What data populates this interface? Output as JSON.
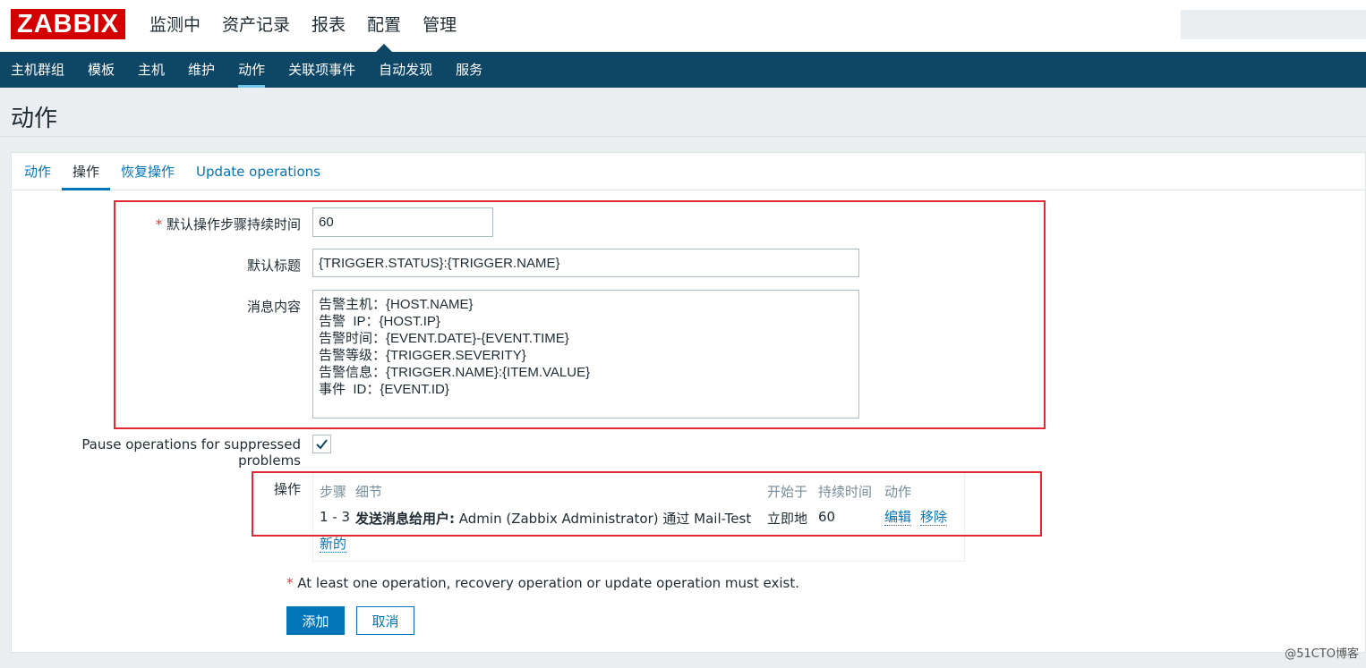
{
  "logo": "ZABBIX",
  "main_menu": [
    "监测中",
    "资产记录",
    "报表",
    "配置",
    "管理"
  ],
  "sub_menu": [
    "主机群组",
    "模板",
    "主机",
    "维护",
    "动作",
    "关联项事件",
    "自动发现",
    "服务"
  ],
  "page_title": "动作",
  "tabs": [
    "动作",
    "操作",
    "恢复操作",
    "Update operations"
  ],
  "form": {
    "step_duration_label": "默认操作步骤持续时间",
    "step_duration_value": "60",
    "subject_label": "默认标题",
    "subject_value": "{TRIGGER.STATUS}:{TRIGGER.NAME}",
    "message_label": "消息内容",
    "message_value": "告警主机：{HOST.NAME}\n告警  IP：{HOST.IP}\n告警时间：{EVENT.DATE}-{EVENT.TIME}\n告警等级：{TRIGGER.SEVERITY}\n告警信息：{TRIGGER.NAME}:{ITEM.VALUE}\n事件  ID：{EVENT.ID}",
    "pause_label": "Pause operations for suppressed problems",
    "pause_checked": true
  },
  "operations": {
    "label": "操作",
    "headers": {
      "steps": "步骤",
      "details": "细节",
      "start_in": "开始于",
      "duration": "持续时间",
      "action": "动作"
    },
    "rows": [
      {
        "steps": "1 - 3",
        "detail_bold": "发送消息给用户:",
        "detail_rest": " Admin (Zabbix Administrator) 通过 Mail-Test",
        "start_in": "立即地",
        "duration": "60",
        "edit": "编辑",
        "remove": "移除"
      }
    ],
    "new_link": "新的"
  },
  "note": "At least one operation, recovery operation or update operation must exist.",
  "buttons": {
    "add": "添加",
    "cancel": "取消"
  },
  "watermark": "@51CTO博客",
  "colors": {
    "nav_bg": "#0e4665",
    "link": "#0275b8",
    "logo": "#d40000",
    "highlight_box": "#e32834"
  }
}
